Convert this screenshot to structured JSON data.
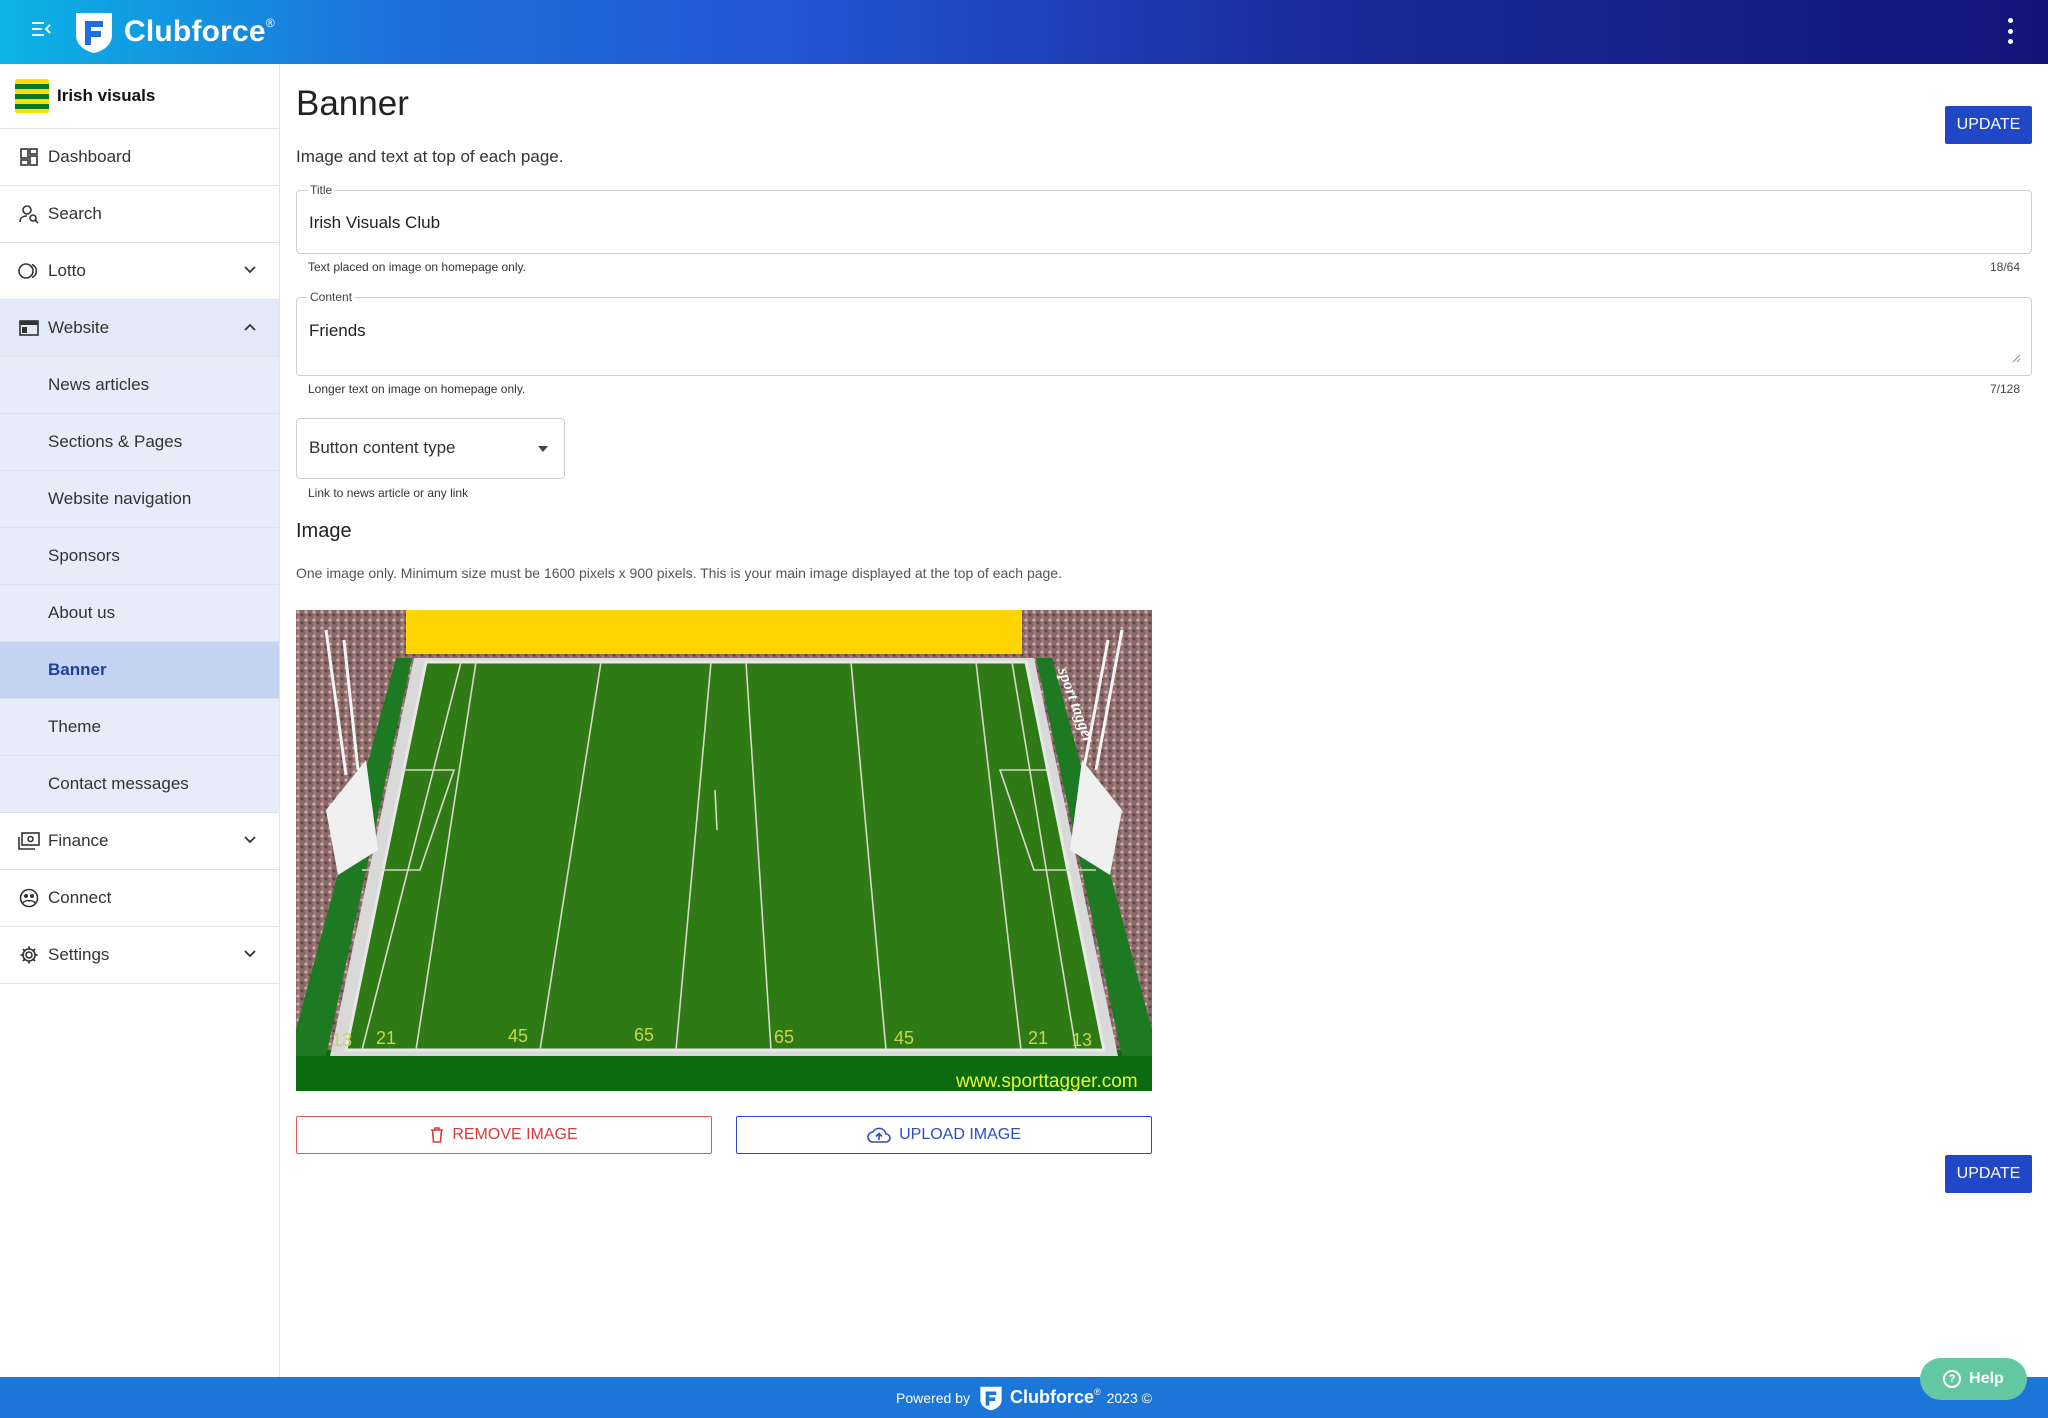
{
  "app": {
    "brand_name": "Clubforce",
    "brand_reg": "®"
  },
  "sidebar": {
    "club_name": "Irish visuals",
    "items": [
      {
        "label": "Dashboard"
      },
      {
        "label": "Search"
      },
      {
        "label": "Lotto"
      },
      {
        "label": "Website"
      },
      {
        "label": "Finance"
      },
      {
        "label": "Connect"
      },
      {
        "label": "Settings"
      }
    ],
    "website_sub": [
      {
        "label": "News articles"
      },
      {
        "label": "Sections & Pages"
      },
      {
        "label": "Website navigation"
      },
      {
        "label": "Sponsors"
      },
      {
        "label": "About us"
      },
      {
        "label": "Banner"
      },
      {
        "label": "Theme"
      },
      {
        "label": "Contact messages"
      }
    ]
  },
  "main": {
    "title": "Banner",
    "update_label": "UPDATE",
    "description": "Image and text at top of each page.",
    "title_field": {
      "label": "Title",
      "value": "Irish Visuals Club",
      "hint": "Text placed on image on homepage only.",
      "counter": "18/64"
    },
    "content_field": {
      "label": "Content",
      "value": "Friends",
      "hint": "Longer text on image on homepage only.",
      "counter": "7/128"
    },
    "button_select": {
      "label": "Button content type",
      "hint": "Link to news article or any link"
    },
    "image_section": {
      "title": "Image",
      "description": "One image only. Minimum size must be 1600 pixels x 900 pixels. This is your main image displayed at the top of each page.",
      "img_text": {
        "url": "www.sporttagger.com",
        "brand": "sport tagger",
        "markings": [
          "13",
          "21",
          "45",
          "65",
          "65",
          "45",
          "21",
          "13"
        ]
      }
    },
    "remove_label": "REMOVE IMAGE",
    "upload_label": "UPLOAD IMAGE"
  },
  "footer": {
    "powered_by": "Powered by",
    "brand": "Clubforce",
    "reg": "®",
    "year": "2023 ©"
  },
  "help": {
    "label": "Help"
  },
  "colors": {
    "primary": "#1f47c6",
    "danger": "#d93a3a",
    "footer": "#1c76d8",
    "help": "#64c7a3"
  }
}
